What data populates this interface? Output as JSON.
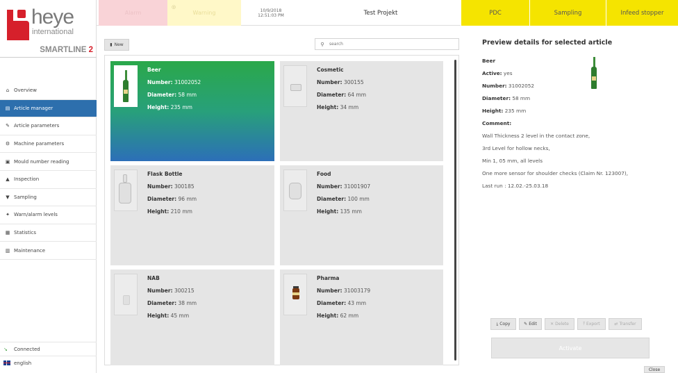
{
  "brand": {
    "name": "heye",
    "sub": "international",
    "product_main": "SMARTLINE",
    "product_num": "2"
  },
  "colors": {
    "accent_red": "#d6202b",
    "nav_active": "#2d6fad",
    "topbar_yellow": "#f5e400",
    "selected_green": "#2aa84a"
  },
  "nav": {
    "items": [
      {
        "label": "Overview",
        "icon": "home-icon"
      },
      {
        "label": "Article manager",
        "icon": "article-icon"
      },
      {
        "label": "Article parameters",
        "icon": "wrench-icon"
      },
      {
        "label": "Machine parameters",
        "icon": "gear-icon"
      },
      {
        "label": "Mould number reading",
        "icon": "mould-icon"
      },
      {
        "label": "Inspection",
        "icon": "inspection-icon"
      },
      {
        "label": "Sampling",
        "icon": "sampling-icon"
      },
      {
        "label": "Warn/alarm levels",
        "icon": "levels-icon"
      },
      {
        "label": "Statistics",
        "icon": "chart-icon"
      },
      {
        "label": "Maintenance",
        "icon": "maintenance-icon"
      }
    ],
    "footer": {
      "connected": "Connected",
      "language": "english"
    }
  },
  "topbar": {
    "alarm": "Alarm",
    "warning": "Warning",
    "date": "10/9/2018",
    "time": "12:51:03 PM",
    "project": "Test Projekt",
    "buttons": [
      "PDC",
      "Sampling",
      "Infeed stopper"
    ]
  },
  "toolbar": {
    "new_label": "New",
    "search_placeholder": "search"
  },
  "articles": [
    {
      "name": "Beer",
      "number": "31002052",
      "diameter": "58 mm",
      "height": "235 mm"
    },
    {
      "name": "Cosmetic",
      "number": "300155",
      "diameter": "64 mm",
      "height": "34 mm"
    },
    {
      "name": "Flask Bottle",
      "number": "300185",
      "diameter": "96 mm",
      "height": "210 mm"
    },
    {
      "name": "Food",
      "number": "31001907",
      "diameter": "100 mm",
      "height": "135 mm"
    },
    {
      "name": "NAB",
      "number": "300215",
      "diameter": "38 mm",
      "height": "45 mm"
    },
    {
      "name": "Pharma",
      "number": "31003179",
      "diameter": "43 mm",
      "height": "62 mm"
    }
  ],
  "labels": {
    "number": "Number:",
    "diameter": "Diameter:",
    "height": "Height:",
    "active": "Active:",
    "comment": "Comment:"
  },
  "details": {
    "title": "Preview details for selected article",
    "name": "Beer",
    "active": "yes",
    "number": "31002052",
    "diameter": "58 mm",
    "height": "235 mm",
    "comment_lines": [
      "Wall Thickness 2 level in the contact zone,",
      "3rd Level for hollow necks,",
      "Min 1, 05 mm, all levels",
      "One more sensor for shoulder checks (Claim Nr. 123007),",
      "Last run : 12.02.-25.03.18"
    ]
  },
  "actions": {
    "copy": "Copy",
    "edit": "Edit",
    "delete": "Delete",
    "export": "Export",
    "transfer": "Transfer",
    "activate": "Activate",
    "close": "Close"
  }
}
